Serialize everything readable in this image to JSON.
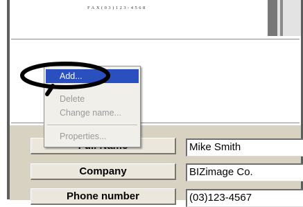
{
  "document": {
    "fax_text": "FAX(03)123-4568"
  },
  "context_menu": {
    "items": [
      {
        "label": "Add...",
        "state": "highlighted"
      },
      {
        "label": "Delete",
        "state": "disabled"
      },
      {
        "label": "Change name...",
        "state": "disabled"
      },
      {
        "label": "Properties...",
        "state": "disabled"
      }
    ]
  },
  "fields": [
    {
      "label": "Full Name",
      "value": "Mike Smith"
    },
    {
      "label": "Company",
      "value": "BIZimage Co."
    },
    {
      "label": "Phone number",
      "value": "(03)123-4567"
    }
  ],
  "colors": {
    "menu_highlight": "#2a4fbf",
    "panel_bg": "#d8d2c2",
    "annotation": "#000000"
  }
}
